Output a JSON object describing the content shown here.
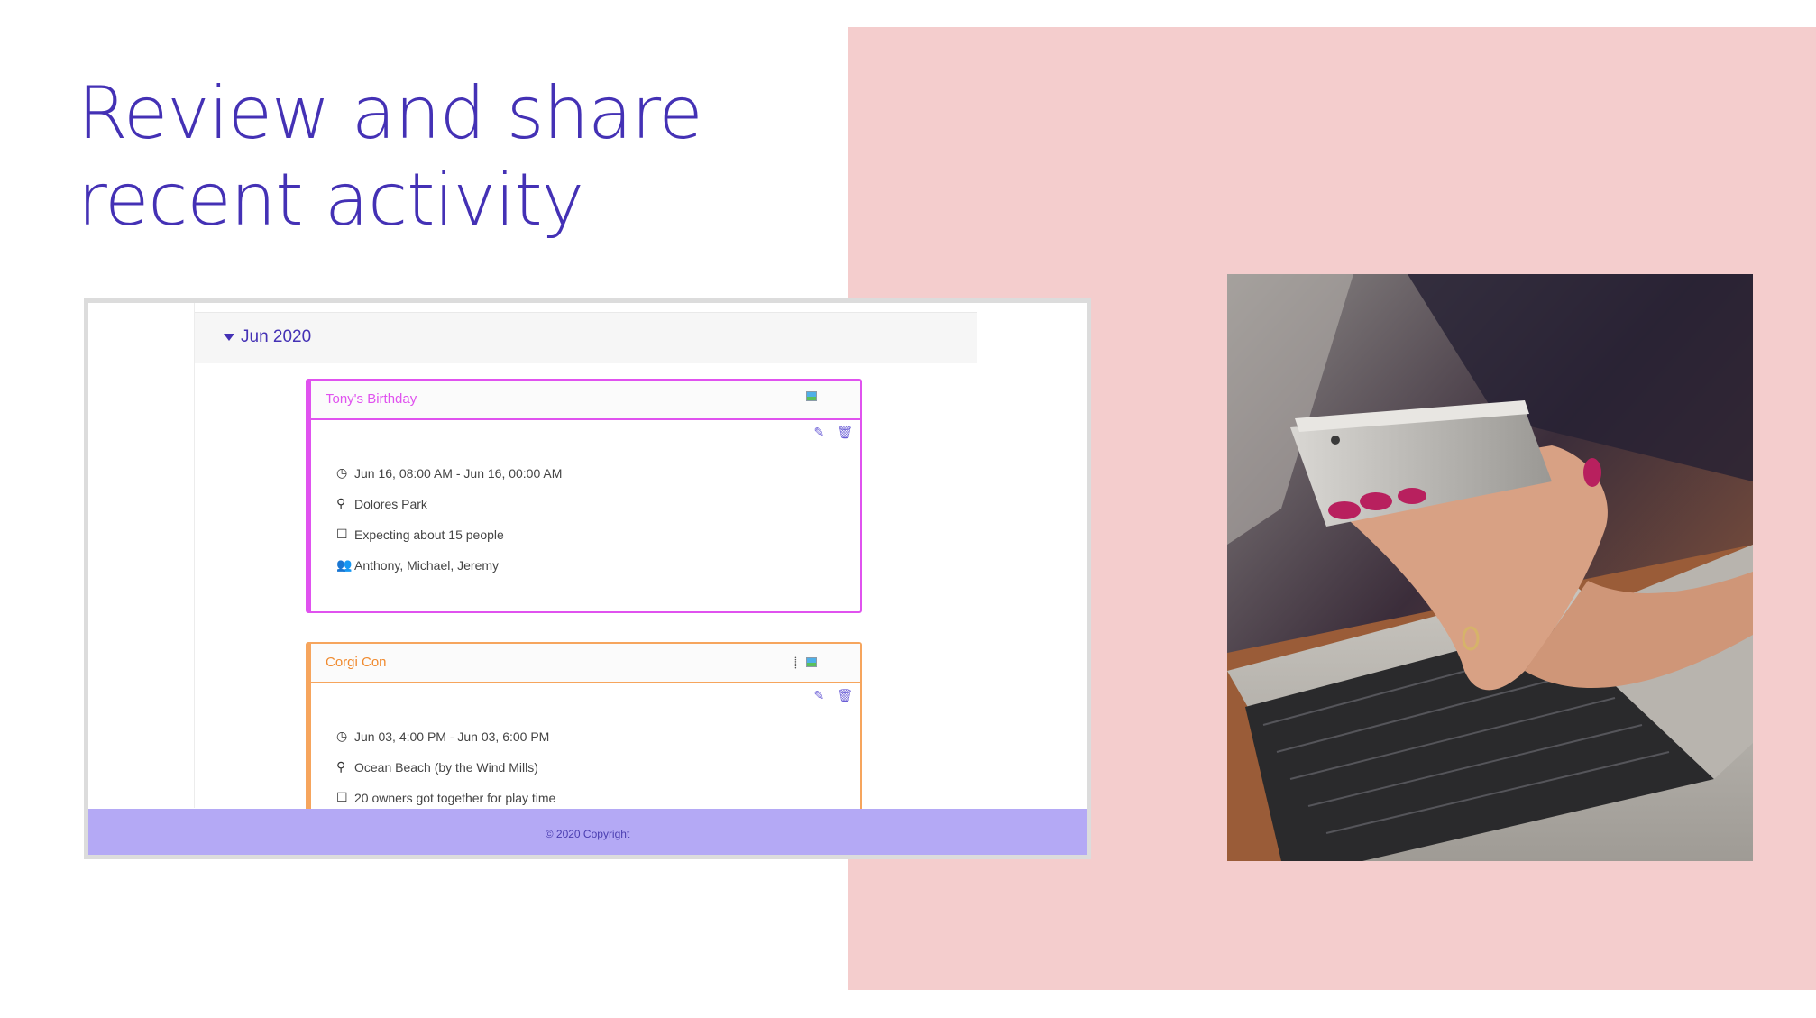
{
  "headline": {
    "line1": "Review and share",
    "line2": "recent activity"
  },
  "timeline": {
    "month_label": "Jun 2020",
    "events": [
      {
        "title": "Tony's Birthday",
        "time": "Jun 16, 08:00 AM - Jun 16, 00:00 AM",
        "location": "Dolores Park",
        "note": "Expecting about 15 people",
        "people": "Anthony, Michael, Jeremy",
        "color": "#e052ef"
      },
      {
        "title": "Corgi Con",
        "time": "Jun 03, 4:00 PM - Jun 03, 6:00 PM",
        "location": "Ocean Beach (by the Wind Mills)",
        "note": "20 owners got together for play time",
        "color": "#f6a55d"
      }
    ]
  },
  "footer": {
    "copyright": "© 2020 Copyright"
  },
  "icons": {
    "caret": "caret-down-icon",
    "image": "image-icon",
    "walk": "footprints-icon",
    "edit": "edit-icon",
    "delete": "trash-icon",
    "clock": "clock-icon",
    "pin": "map-pin-icon",
    "note": "note-icon",
    "people": "users-icon"
  },
  "colors": {
    "accent": "#4431b5",
    "panel": "#f4cdcd",
    "footer": "#b4a9f5"
  }
}
